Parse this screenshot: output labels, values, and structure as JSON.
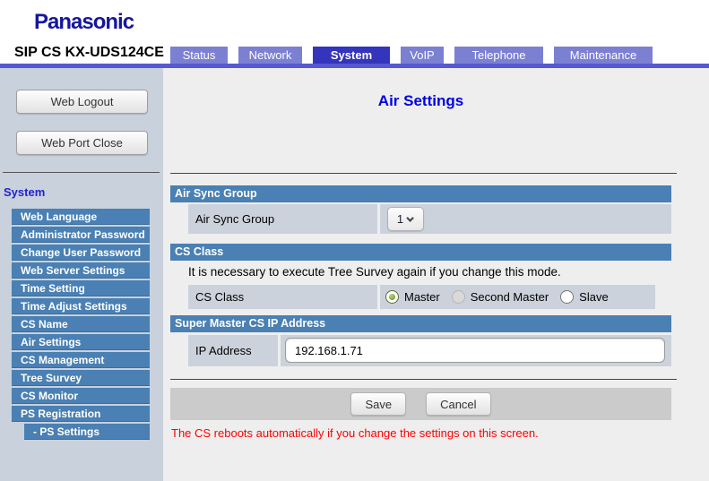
{
  "brand": "Panasonic",
  "device_title": "SIP CS KX-UDS124CE",
  "tabs": [
    {
      "label": "Status",
      "active": false
    },
    {
      "label": "Network",
      "active": false
    },
    {
      "label": "System",
      "active": true
    },
    {
      "label": "VoIP",
      "active": false
    },
    {
      "label": "Telephone",
      "active": false
    },
    {
      "label": "Maintenance",
      "active": false
    }
  ],
  "sidebar": {
    "web_logout_button": "Web Logout",
    "web_port_close_button": "Web Port Close",
    "section_title": "System",
    "items": [
      "Web Language",
      "Administrator Password",
      "Change User Password",
      "Web Server Settings",
      "Time Setting",
      "Time Adjust Settings",
      "CS Name",
      "Air Settings",
      "CS Management",
      "Tree Survey",
      "CS Monitor",
      "PS Registration"
    ],
    "sub_item": "- PS Settings"
  },
  "main": {
    "page_title": "Air Settings",
    "air_sync_group": {
      "header": "Air Sync Group",
      "label": "Air Sync Group",
      "selected_value": "1"
    },
    "cs_class": {
      "header": "CS Class",
      "note": "It is necessary to execute Tree Survey again if you change this mode.",
      "label": "CS Class",
      "radios": [
        {
          "label": "Master",
          "selected": true
        },
        {
          "label": "Second Master",
          "selected": false
        },
        {
          "label": "Slave",
          "selected": false
        }
      ]
    },
    "super_master": {
      "header": "Super Master CS IP Address",
      "label": "IP Address",
      "value": "192.168.1.71"
    },
    "save_button": "Save",
    "cancel_button": "Cancel",
    "warning": "The CS reboots automatically if you change the settings on this screen."
  },
  "colors": {
    "brand_blue": "#16169c",
    "tab_active": "#3434bc",
    "tab_inactive": "#7c80d3",
    "accent_bar": "#5659cf",
    "section_header_blue": "#4a80b3",
    "sidebar_bg": "#c9d1dd",
    "row_cell_bg": "#ccd2db",
    "page_title_blue": "#0000e6",
    "warning_red": "#ff0000",
    "radio_selected_green": "#7aa33a"
  }
}
